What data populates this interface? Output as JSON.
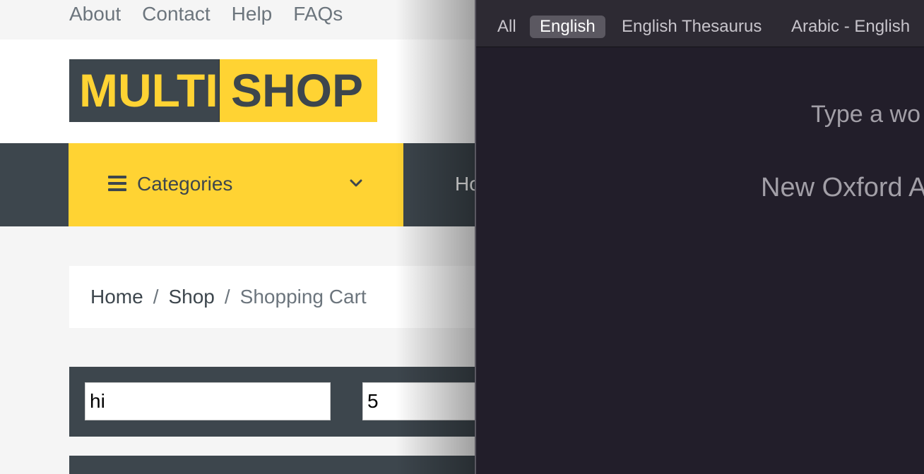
{
  "site": {
    "top_links": [
      "About",
      "Contact",
      "Help",
      "FAQs"
    ],
    "logo": {
      "part1": "MULTI",
      "part2": "SHOP"
    },
    "categories_label": "Categories",
    "nav_partial": "Ho",
    "breadcrumb": {
      "home": "Home",
      "sep": "/",
      "shop": "Shop",
      "current": "Shopping Cart"
    },
    "form": {
      "field1_value": "hi",
      "field2_value": "5"
    },
    "colors": {
      "accent": "#ffd333",
      "dark": "#3d464d"
    }
  },
  "dictionary": {
    "tabs": [
      "All",
      "English",
      "English Thesaurus",
      "Arabic - English"
    ],
    "selected_tab": "English",
    "hint": "Type a wo",
    "source": "New Oxford A"
  }
}
